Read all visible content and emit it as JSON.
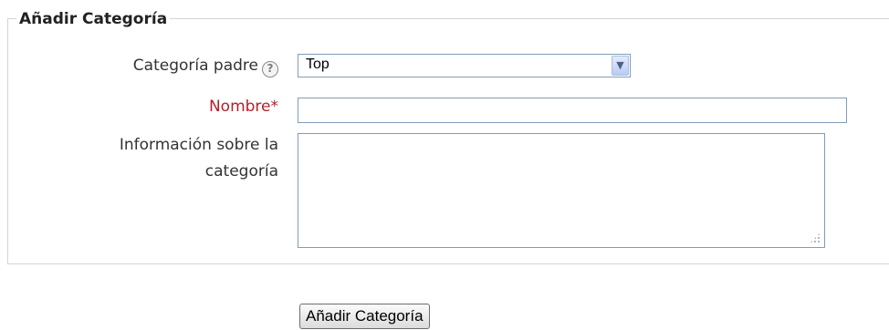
{
  "form": {
    "legend": "Añadir Categoría",
    "fields": {
      "parent": {
        "label": "Categoría padre",
        "help_icon": "help-icon",
        "selected": "Top"
      },
      "name": {
        "label": "Nombre",
        "required_mark": "*",
        "value": ""
      },
      "description": {
        "label_line1": "Información sobre la",
        "label_line2": "categoría",
        "value": ""
      }
    },
    "submit_label": "Añadir Categoría"
  },
  "colors": {
    "required": "#b61f2a",
    "input_border": "#7f9db9",
    "fieldset_border": "#d4d4d4"
  }
}
